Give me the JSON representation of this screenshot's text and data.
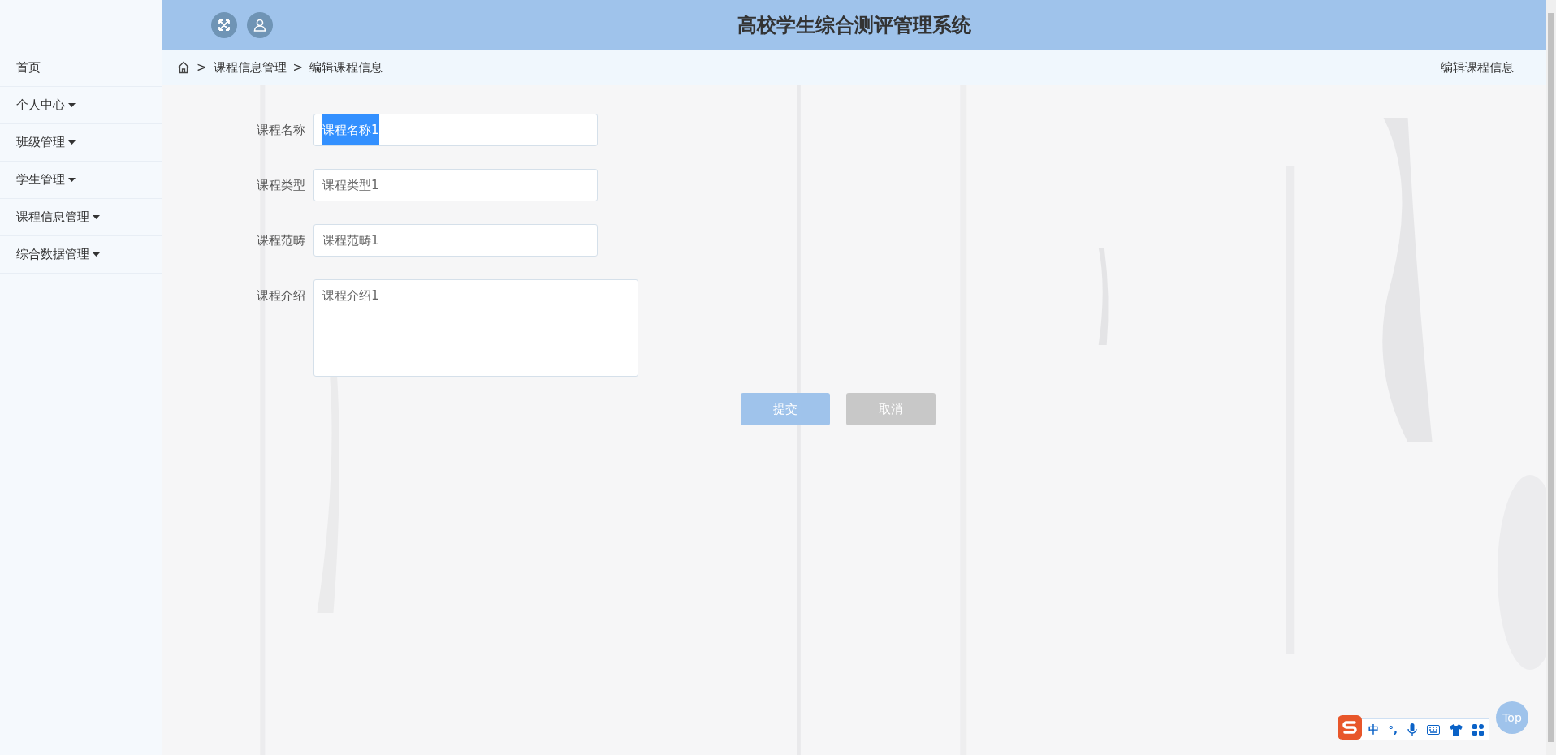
{
  "header": {
    "title": "高校学生综合测评管理系统"
  },
  "sidebar": {
    "items": [
      {
        "label": "首页",
        "dropdown": false
      },
      {
        "label": "个人中心",
        "dropdown": true
      },
      {
        "label": "班级管理",
        "dropdown": true
      },
      {
        "label": "学生管理",
        "dropdown": true
      },
      {
        "label": "课程信息管理",
        "dropdown": true
      },
      {
        "label": "综合数据管理",
        "dropdown": true
      }
    ]
  },
  "breadcrumb": {
    "items": [
      ">",
      "课程信息管理",
      ">",
      "编辑课程信息"
    ],
    "page_title": "编辑课程信息"
  },
  "form": {
    "fields": [
      {
        "kind": "input",
        "label": "课程名称",
        "value": "课程名称1",
        "highlighted": true
      },
      {
        "kind": "input",
        "label": "课程类型",
        "value": "课程类型1",
        "highlighted": false
      },
      {
        "kind": "input",
        "label": "课程范畴",
        "value": "课程范畴1",
        "highlighted": false
      },
      {
        "kind": "textarea",
        "label": "课程介绍",
        "value": "课程介绍1",
        "highlighted": false
      }
    ],
    "buttons": [
      {
        "kind": "primary",
        "label": "提交"
      },
      {
        "kind": "secondary",
        "label": "取消"
      }
    ]
  },
  "top_button": {
    "label": "Top"
  },
  "ime_toolbar": {
    "mode": "中",
    "punctuation": "°,"
  }
}
